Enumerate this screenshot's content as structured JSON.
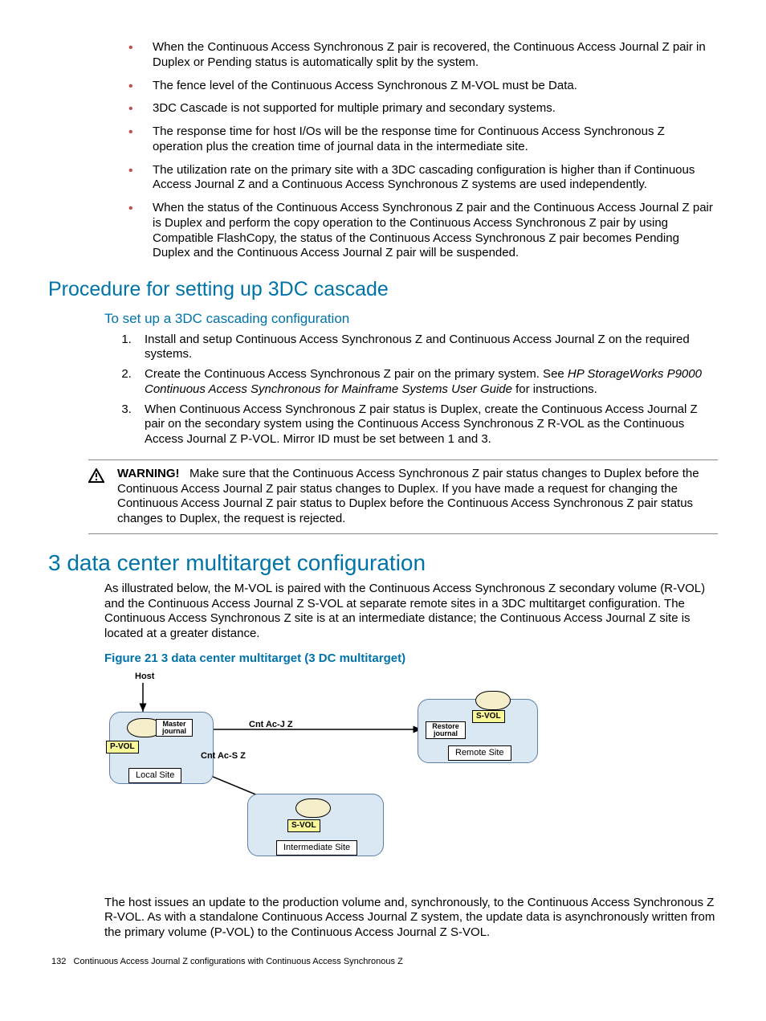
{
  "bullets": [
    "When the Continuous Access Synchronous Z pair is recovered, the Continuous Access Journal Z pair in Duplex or Pending status is automatically split by the system.",
    "The fence level of the Continuous Access Synchronous Z M-VOL must be Data.",
    "3DC Cascade is not supported for multiple primary and secondary systems.",
    "The response time for host I/Os will be the response time for Continuous Access Synchronous Z operation plus the creation time of journal data in the intermediate site.",
    "The utilization rate on the primary site with a 3DC cascading configuration is higher than if Continuous Access Journal Z and a Continuous Access Synchronous Z systems are used independently.",
    "When the status of the Continuous Access Synchronous Z pair and the Continuous Access Journal Z pair is Duplex and perform the copy operation to the Continuous Access Synchronous Z pair by using Compatible FlashCopy, the status of the Continuous Access Synchronous Z pair becomes Pending Duplex and the Continuous Access Journal Z pair will be suspended."
  ],
  "h_procedure": "Procedure for setting up 3DC cascade",
  "h_toset": "To set up a 3DC cascading configuration",
  "steps": {
    "s1": "Install and setup Continuous Access Synchronous Z and Continuous Access Journal Z on the required systems.",
    "s2a": "Create the Continuous Access Synchronous Z pair on the primary system. See ",
    "s2b": "HP StorageWorks P9000 Continuous Access Synchronous for Mainframe Systems User Guide",
    "s2c": " for instructions.",
    "s3": "When Continuous Access Synchronous Z pair status is Duplex, create the Continuous Access Journal Z pair on the secondary system using the Continuous Access Synchronous Z R-VOL as the Continuous Access Journal Z P-VOL. Mirror ID must be set between 1 and 3."
  },
  "warn_label": "WARNING!",
  "warn_text": "Make sure that the Continuous Access Synchronous Z pair status changes to Duplex before the Continuous Access Journal Z pair status changes to Duplex. If you have made a request for changing the Continuous Access Journal Z pair status to Duplex before the Continuous Access Synchronous Z pair status changes to Duplex, the request is rejected.",
  "h_main": "3 data center multitarget configuration",
  "para1": "As illustrated below, the M-VOL is paired with the Continuous Access Synchronous Z secondary volume (R-VOL) and the Continuous Access Journal Z S-VOL at separate remote sites in a 3DC multitarget configuration. The Continuous Access Synchronous Z site is at an intermediate distance; the Continuous Access Journal Z site is located at a greater distance.",
  "fig_caption": "Figure 21 3 data center multitarget (3 DC multitarget)",
  "diagram": {
    "host": "Host",
    "master_journal": "Master\njournal",
    "pvol": "P-VOL",
    "local_site": "Local Site",
    "cnt_ac_jz": "Cnt Ac-J Z",
    "cnt_ac_sz": "Cnt Ac-S Z",
    "svol": "S-VOL",
    "restore_journal": "Restore\njournal",
    "remote_site": "Remote Site",
    "intermediate_site": "Intermediate Site"
  },
  "para2": "The host issues an update to the production volume and, synchronously, to the Continuous Access Synchronous Z R-VOL. As with a standalone Continuous Access Journal Z system, the update data is asynchronously written from the primary volume (P-VOL) to the Continuous Access Journal Z S-VOL.",
  "footer_page": "132",
  "footer_text": "Continuous Access Journal Z configurations with Continuous Access Synchronous Z",
  "chart_data": {
    "type": "diagram",
    "nodes": [
      {
        "id": "host",
        "label": "Host"
      },
      {
        "id": "local_site",
        "label": "Local Site",
        "contains": [
          "P-VOL",
          "Master journal"
        ]
      },
      {
        "id": "intermediate_site",
        "label": "Intermediate Site",
        "contains": [
          "S-VOL"
        ]
      },
      {
        "id": "remote_site",
        "label": "Remote Site",
        "contains": [
          "S-VOL",
          "Restore journal"
        ]
      }
    ],
    "edges": [
      {
        "from": "host",
        "to": "local_site",
        "label": ""
      },
      {
        "from": "local_site",
        "to": "remote_site",
        "label": "Cnt Ac-J Z"
      },
      {
        "from": "local_site",
        "to": "intermediate_site",
        "label": "Cnt Ac-S Z"
      }
    ]
  }
}
